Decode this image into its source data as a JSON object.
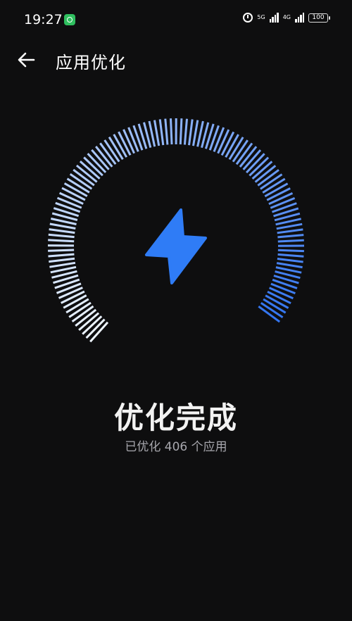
{
  "status_bar": {
    "time": "19:27",
    "network_5g": "5G",
    "network_4g": "4G",
    "battery": "100"
  },
  "header": {
    "title": "应用优化"
  },
  "gauge": {
    "icon": "lightning-bolt-icon",
    "accent_color": "#2f7cf6",
    "level": 1.0
  },
  "result": {
    "title": "优化完成",
    "subtitle": "已优化 406 个应用"
  }
}
